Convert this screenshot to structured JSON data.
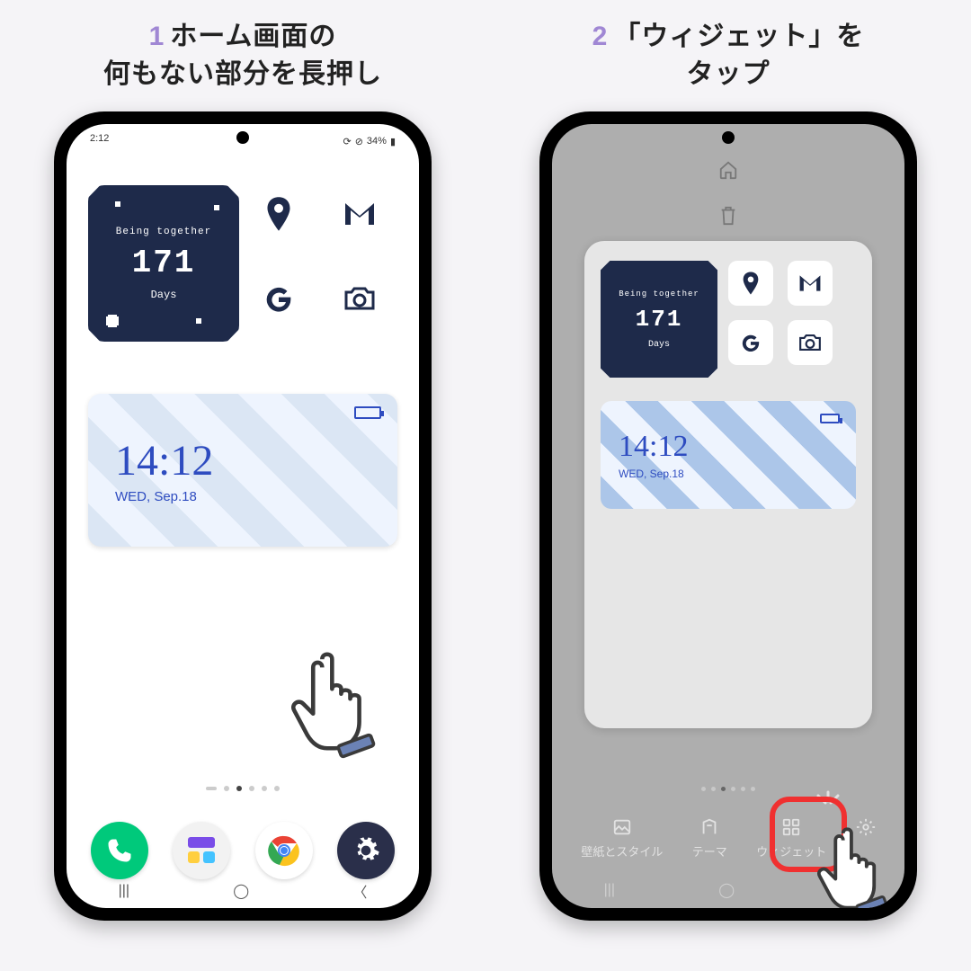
{
  "step1": {
    "num": "1",
    "title_line1": "ホーム画面の",
    "title_line2": "何もない部分を長押し",
    "statusbar": {
      "time": "2:12",
      "battery": "34%"
    },
    "widget": {
      "sub": "Being together",
      "num": "171",
      "days": "Days"
    },
    "clock": {
      "time": "14:12",
      "date": "WED, Sep.18"
    },
    "dock_icons": [
      "phone-icon",
      "widgets-icon",
      "chrome-icon",
      "settings-icon"
    ]
  },
  "step2": {
    "num": "2",
    "title_line1": "「ウィジェット」を",
    "title_line2": "タップ",
    "widget": {
      "sub": "Being together",
      "num": "171",
      "days": "Days"
    },
    "clock": {
      "time": "14:12",
      "date": "WED, Sep.18"
    },
    "actions": {
      "wallpaper": "壁紙とスタイル",
      "themes": "テーマ",
      "widgets": "ウィジェット",
      "settings": ""
    }
  }
}
